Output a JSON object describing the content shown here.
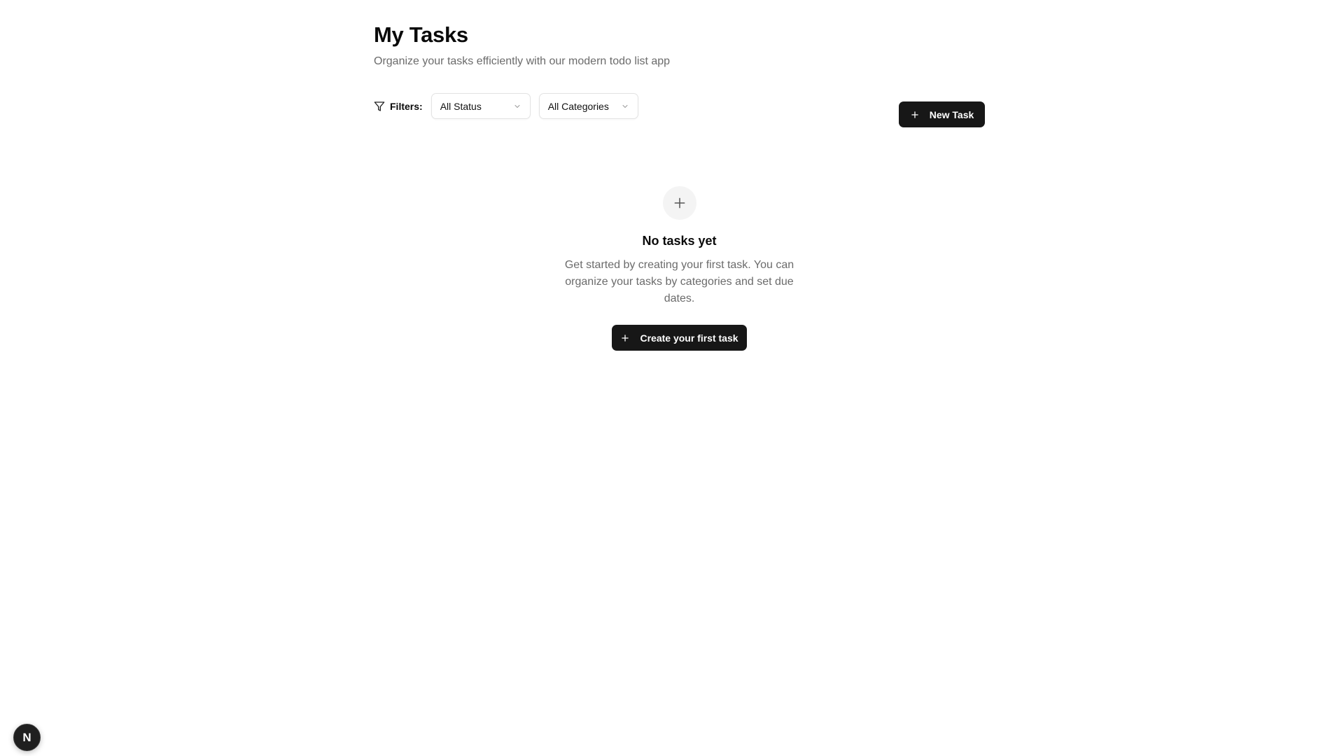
{
  "header": {
    "title": "My Tasks",
    "subtitle": "Organize your tasks efficiently with our modern todo list app"
  },
  "filters": {
    "icon": "filter-icon",
    "label": "Filters:",
    "status_select": {
      "selected": "All Status",
      "icon": "chevron-down-icon"
    },
    "category_select": {
      "selected": "All Categories",
      "icon": "chevron-down-icon"
    }
  },
  "toolbar": {
    "new_task_label": "New Task",
    "new_task_icon": "plus-icon"
  },
  "empty_state": {
    "icon": "plus-icon",
    "title": "No tasks yet",
    "description": "Get started by creating your first task. You can organize your tasks by categories and set due dates.",
    "cta_label": "Create your first task",
    "cta_icon": "plus-icon"
  },
  "dev_badge": {
    "letter": "N"
  },
  "colors": {
    "primary_button": "#171717",
    "muted_text": "#6b6b6b",
    "border": "#e3e3e3",
    "icon_circle_bg": "#f4f4f4"
  }
}
